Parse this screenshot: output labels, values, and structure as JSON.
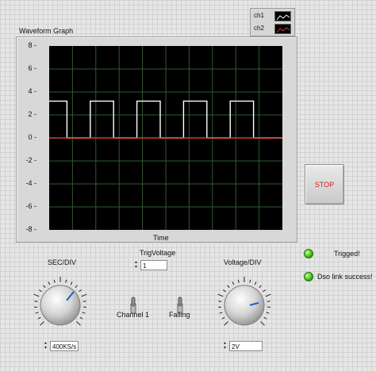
{
  "graph": {
    "title": "Waveform Graph",
    "x_axis_label": "Time",
    "y_ticks": [
      "8",
      "6",
      "4",
      "2",
      "0",
      "-2",
      "-4",
      "-6",
      "-8"
    ],
    "legend": [
      {
        "label": "ch1",
        "color": "#ffffff"
      },
      {
        "label": "ch2",
        "color": "#d63a3a"
      }
    ]
  },
  "chart_data": {
    "type": "line",
    "title": "Waveform Graph",
    "xlabel": "Time",
    "ylabel": "",
    "ylim": [
      -8,
      8
    ],
    "grid": true,
    "legend_placement": "top-right",
    "series": [
      {
        "name": "ch1",
        "color": "#ffffff",
        "waveform": "square",
        "high": 3.2,
        "low": 0,
        "cycles": 5,
        "duty": 0.5
      },
      {
        "name": "ch2",
        "color": "#d63a3a",
        "waveform": "flat",
        "value": 0
      }
    ]
  },
  "stop_button": {
    "label": "STOP"
  },
  "indicators": {
    "trigged": {
      "label": "Trigged!",
      "color": "#3fc21a"
    },
    "dso_link": {
      "label": "Dso link success!",
      "color": "#3fc21a"
    }
  },
  "sec_div": {
    "label": "SEC/DIV",
    "value": "400KS/s"
  },
  "trig_voltage": {
    "label": "TrigVoltage",
    "value": "1"
  },
  "voltage_div": {
    "label": "Voltage/DIV",
    "value": "2V"
  },
  "switches": {
    "channel": {
      "label": "Channel 1"
    },
    "edge": {
      "label": "Falling"
    }
  },
  "colors": {
    "plot_bg": "#000000",
    "grid": "#2f5a2f",
    "accent_needle": "#1a5fc4"
  }
}
